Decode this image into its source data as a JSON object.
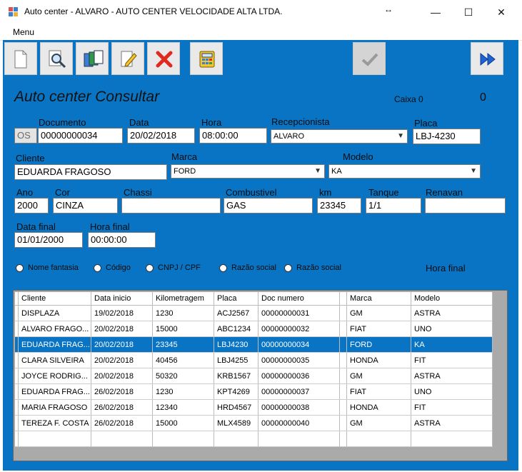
{
  "window": {
    "title": "Auto center - ALVARO - AUTO CENTER VELOCIDADE ALTA LTDA.",
    "minimize_glyph": "—",
    "maximize_glyph": "☐",
    "close_glyph": "✕",
    "resize_glyph": "↔"
  },
  "menu": {
    "label": "Menu"
  },
  "header": {
    "title": "Auto center  Consultar",
    "caixa_label": "Caixa 0",
    "caixa_value": "0"
  },
  "form": {
    "os_label": "OS",
    "documento_label": "Documento",
    "documento": "00000000034",
    "data_label": "Data",
    "data": "20/02/2018",
    "hora_label": "Hora",
    "hora": "08:00:00",
    "recepcionista_label": "Recepcionista",
    "recepcionista": "ALVARO",
    "placa_label": "Placa",
    "placa": "LBJ-4230",
    "cliente_label": "Cliente",
    "cliente": "EDUARDA FRAGOSO",
    "marca_label": "Marca",
    "marca": "FORD",
    "modelo_label": "Modelo",
    "modelo": "KA",
    "ano_label": "Ano",
    "ano": "2000",
    "cor_label": "Cor",
    "cor": "CINZA",
    "chassi_label": "Chassi",
    "chassi": "",
    "combustivel_label": "Combustivel",
    "combustivel": "GAS",
    "km_label": "km",
    "km": "23345",
    "tanque_label": "Tanque",
    "tanque": "1/1",
    "renavan_label": "Renavan",
    "renavan": "",
    "data_final_label": "Data final",
    "data_final": "01/01/2000",
    "hora_final_label": "Hora final",
    "hora_final": "00:00:00"
  },
  "radios": [
    "Nome fantasia",
    "Código",
    "CNPJ / CPF",
    "Razão social",
    "Razão social"
  ],
  "hora_final_caption": "Hora final",
  "grid": {
    "columns": [
      "Cliente",
      "Data inicio",
      "Kilometragem",
      "Placa",
      "Doc numero",
      "",
      "Marca",
      "Modelo"
    ],
    "rows": [
      [
        "DISPLAZA",
        "19/02/2018",
        "1230",
        "ACJ2567",
        "00000000031",
        "",
        "GM",
        "ASTRA"
      ],
      [
        "ALVARO FRAGO...",
        "20/02/2018",
        "15000",
        "ABC1234",
        "00000000032",
        "",
        "FIAT",
        "UNO"
      ],
      [
        "EDUARDA FRAG...",
        "20/02/2018",
        "23345",
        "LBJ4230",
        "00000000034",
        "",
        "FORD",
        "KA"
      ],
      [
        "CLARA SILVEIRA",
        "20/02/2018",
        "40456",
        "LBJ4255",
        "00000000035",
        "",
        "HONDA",
        "FIT"
      ],
      [
        "JOYCE RODRIG...",
        "20/02/2018",
        "50320",
        "KRB1567",
        "00000000036",
        "",
        "GM",
        "ASTRA"
      ],
      [
        "EDUARDA FRAG...",
        "26/02/2018",
        "1230",
        "KPT4269",
        "00000000037",
        "",
        "FIAT",
        "UNO"
      ],
      [
        "MARIA FRAGOSO",
        "26/02/2018",
        "12340",
        "HRD4567",
        "00000000038",
        "",
        "HONDA",
        "FIT"
      ],
      [
        "TEREZA F. COSTA",
        "26/02/2018",
        "15000",
        "MLX4589",
        "00000000040",
        "",
        "GM",
        "ASTRA"
      ]
    ],
    "selected_row": 2
  }
}
